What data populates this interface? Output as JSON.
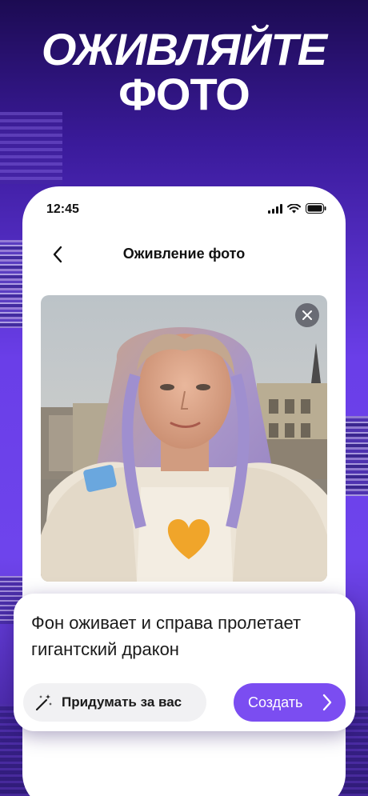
{
  "headline": {
    "line1": "ОЖИВЛЯЙТЕ",
    "line2": "ФОТО"
  },
  "status_bar": {
    "time": "12:45",
    "icons": [
      "cellular-signal-icon",
      "wifi-icon",
      "battery-icon"
    ]
  },
  "nav": {
    "title": "Оживление фото",
    "back_icon": "chevron-left-icon"
  },
  "photo": {
    "close_icon": "close-icon"
  },
  "prompt": {
    "text": "Фон оживает и справа пролетает гигантский дракон",
    "suggest_label": "Придумать за вас",
    "suggest_icon": "magic-wand-icon",
    "create_label": "Создать",
    "create_icon": "chevron-right-icon"
  },
  "colors": {
    "accent": "#7b4df1",
    "background_top": "#1c0b52",
    "background_mid": "#6a3ee8"
  }
}
